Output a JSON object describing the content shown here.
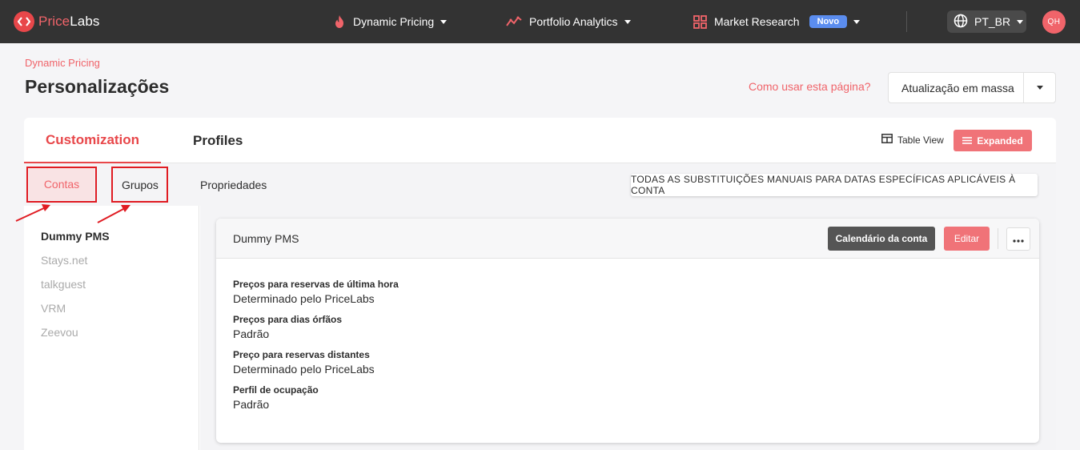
{
  "nav": {
    "logo_price": "Price",
    "logo_labs": "Labs",
    "dynamic_pricing": "Dynamic Pricing",
    "portfolio_analytics": "Portfolio Analytics",
    "market_research": "Market Research",
    "badge": "Novo",
    "language": "PT_BR",
    "avatar": "QH"
  },
  "header": {
    "breadcrumb": "Dynamic Pricing",
    "title": "Personalizações",
    "help": "Como usar esta página?",
    "bulk_update": "Atualização em massa"
  },
  "tabs": {
    "customization": "Customization",
    "profiles": "Profiles",
    "table_view": "Table View",
    "expanded": "Expanded"
  },
  "subtabs": {
    "contas": "Contas",
    "grupos": "Grupos",
    "propriedades": "Propriedades",
    "all_overrides": "TODAS AS SUBSTITUIÇÕES MANUAIS PARA DATAS ESPECÍFICAS APLICÁVEIS À CONTA"
  },
  "accounts": [
    "Dummy PMS",
    "Stays.net",
    "talkguest",
    "VRM",
    "Zeevou"
  ],
  "detail": {
    "title": "Dummy PMS",
    "calendar_btn": "Calendário da conta",
    "edit_btn": "Editar",
    "settings": [
      {
        "label": "Preços para reservas de última hora",
        "value": "Determinado pelo PriceLabs"
      },
      {
        "label": "Preços para dias órfãos",
        "value": "Padrão"
      },
      {
        "label": "Preço para reservas distantes",
        "value": "Determinado pelo PriceLabs"
      },
      {
        "label": "Perfil de ocupação",
        "value": "Padrão"
      }
    ]
  },
  "colors": {
    "brand": "#e8474a",
    "accent_light": "#f07378",
    "topbar": "#333333",
    "annotation": "#e01b22"
  }
}
